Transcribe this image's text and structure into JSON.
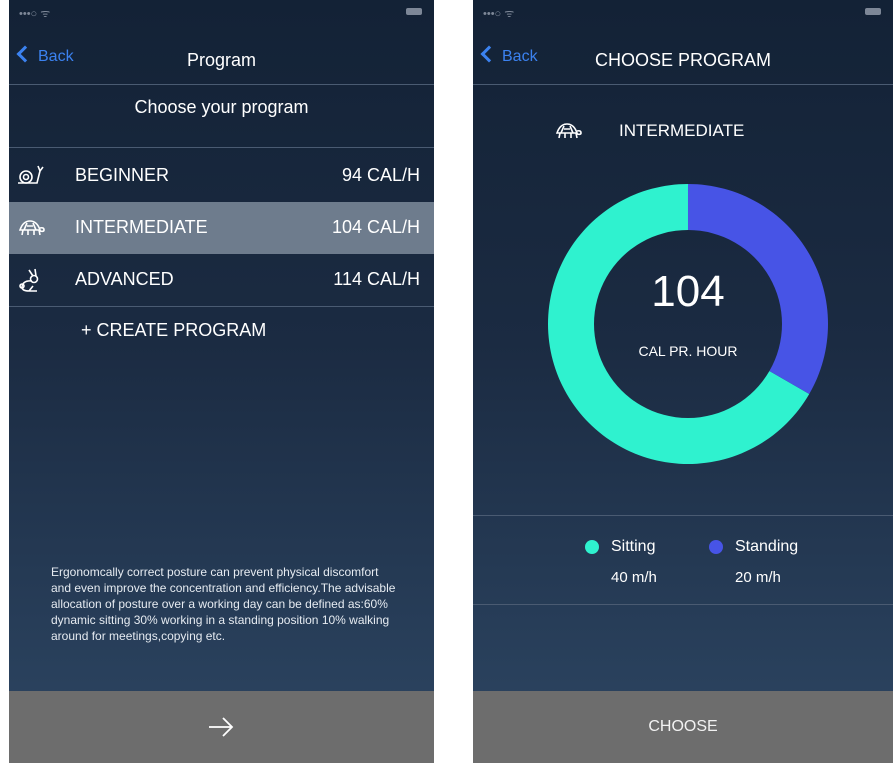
{
  "left_screen": {
    "nav": {
      "back_label": "Back",
      "title": "Program"
    },
    "subtitle": "Choose your program",
    "programs": [
      {
        "icon": "snail-icon",
        "name": "BEGINNER",
        "calories": "94 CAL/H",
        "selected": false
      },
      {
        "icon": "turtle-icon",
        "name": "INTERMEDIATE",
        "calories": "104 CAL/H",
        "selected": true
      },
      {
        "icon": "rabbit-icon",
        "name": "ADVANCED",
        "calories": "114 CAL/H",
        "selected": false
      }
    ],
    "create_label": "+ CREATE PROGRAM",
    "info_text": "Ergonomcally correct posture can prevent physical discomfort and even improve the concentration and efficiency.The advisable allocation of posture over a working day can be defined as:60% dynamic sitting 30% working in a standing position 10% walking around for meetings,copying etc.",
    "footer": {
      "icon": "arrow-right-icon"
    }
  },
  "right_screen": {
    "nav": {
      "back_label": "Back",
      "title": "CHOOSE PROGRAM"
    },
    "program": {
      "icon": "turtle-icon",
      "name": "INTERMEDIATE"
    },
    "donut": {
      "value": "104",
      "unit_label": "CAL PR. HOUR"
    },
    "legend": [
      {
        "label": "Sitting",
        "value": "40 m/h"
      },
      {
        "label": "Standing",
        "value": "20 m/h"
      }
    ],
    "choose_label": "CHOOSE"
  },
  "colors": {
    "sitting": "#2ff2cf",
    "standing": "#4754e6",
    "accent": "#3b82f0"
  },
  "chart_data": {
    "type": "pie",
    "categories": [
      "Sitting",
      "Standing"
    ],
    "values": [
      40,
      20
    ],
    "colors": [
      "#2ff2cf",
      "#4754e6"
    ],
    "center_value": "104",
    "center_label": "CAL PR. HOUR"
  }
}
